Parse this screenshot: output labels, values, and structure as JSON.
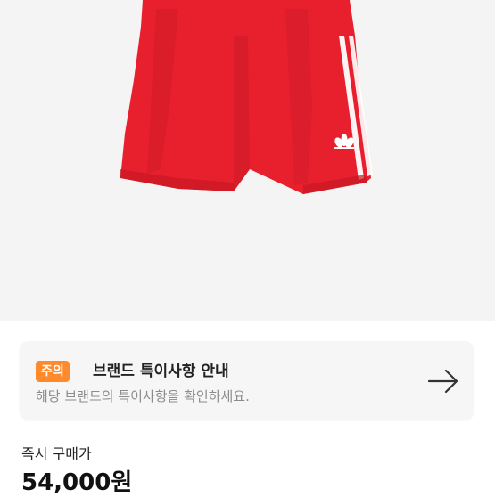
{
  "product": {
    "image_alt": "adidas red shorts",
    "brand_mark": "adidas"
  },
  "notice": {
    "badge": "주의",
    "title": "브랜드 특이사항 안내",
    "description": "해당 브랜드의 특이사항을 확인하세요.",
    "arrow_icon": "arrow-right-icon"
  },
  "price": {
    "label": "즉시 구매가",
    "value": "54,000원"
  },
  "colors": {
    "badge": "#ff8a2b",
    "shorts": "#e8202e"
  }
}
